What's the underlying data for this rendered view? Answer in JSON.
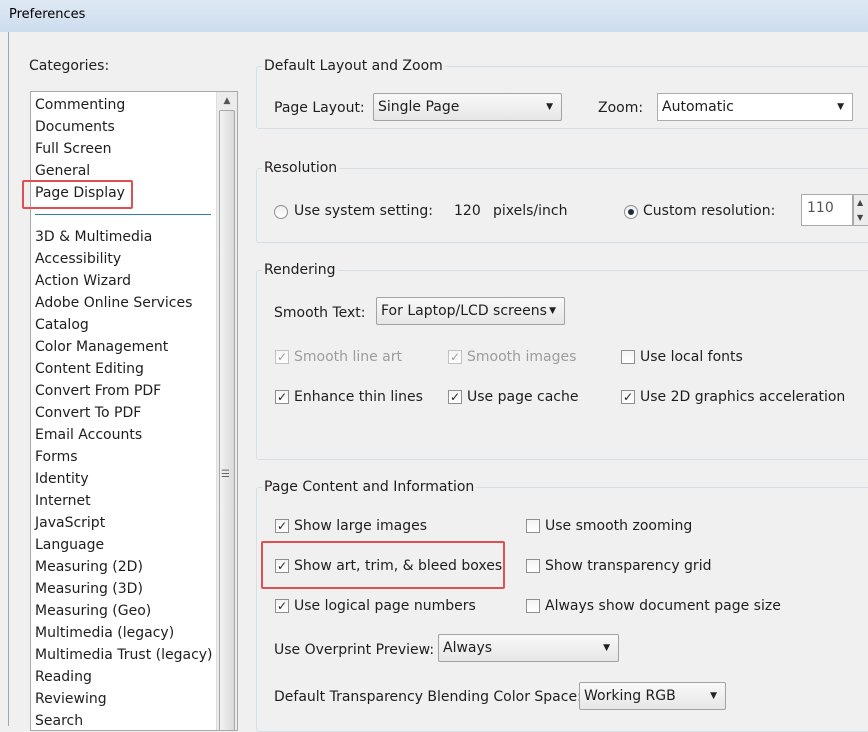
{
  "window": {
    "title": "Preferences",
    "title_ghost": ""
  },
  "categories": {
    "label": "Categories:",
    "items": [
      "Commenting",
      "Documents",
      "Full Screen",
      "General",
      "Page Display",
      "3D & Multimedia",
      "Accessibility",
      "Action Wizard",
      "Adobe Online Services",
      "Catalog",
      "Color Management",
      "Content Editing",
      "Convert From PDF",
      "Convert To PDF",
      "Email Accounts",
      "Forms",
      "Identity",
      "Internet",
      "JavaScript",
      "Language",
      "Measuring (2D)",
      "Measuring (3D)",
      "Measuring (Geo)",
      "Multimedia (legacy)",
      "Multimedia Trust (legacy)",
      "Reading",
      "Reviewing",
      "Search"
    ],
    "selected": "Page Display"
  },
  "layout_zoom": {
    "legend": "Default Layout and Zoom",
    "page_layout_label": "Page Layout:",
    "page_layout_value": "Single Page",
    "zoom_label": "Zoom:",
    "zoom_value": "Automatic"
  },
  "resolution": {
    "legend": "Resolution",
    "use_system_label": "Use system setting:",
    "system_value": "120",
    "system_unit": "pixels/inch",
    "custom_label": "Custom resolution:",
    "custom_value": "110",
    "selected": "custom"
  },
  "rendering": {
    "legend": "Rendering",
    "smooth_text_label": "Smooth Text:",
    "smooth_text_value": "For Laptop/LCD screens",
    "smooth_line_art": "Smooth line art",
    "smooth_images": "Smooth images",
    "use_local_fonts": "Use local fonts",
    "enhance_thin_lines": "Enhance thin lines",
    "use_page_cache": "Use page cache",
    "use_2d_accel": "Use 2D graphics acceleration"
  },
  "page_content": {
    "legend": "Page Content and Information",
    "show_large_images": "Show large images",
    "use_smooth_zooming": "Use smooth zooming",
    "show_art_trim_bleed": "Show art, trim, & bleed boxes",
    "show_transparency_grid": "Show transparency grid",
    "use_logical_page_numbers": "Use logical page numbers",
    "always_show_page_size": "Always show document page size",
    "overprint_label": "Use Overprint Preview:",
    "overprint_value": "Always",
    "blending_label": "Default Transparency Blending Color Space:",
    "blending_value": "Working RGB"
  },
  "checkmark": "✓",
  "colors": {
    "highlight": "#e05050",
    "titlebar": "#dfe9f5",
    "selection_line": "#2b7ec2"
  }
}
